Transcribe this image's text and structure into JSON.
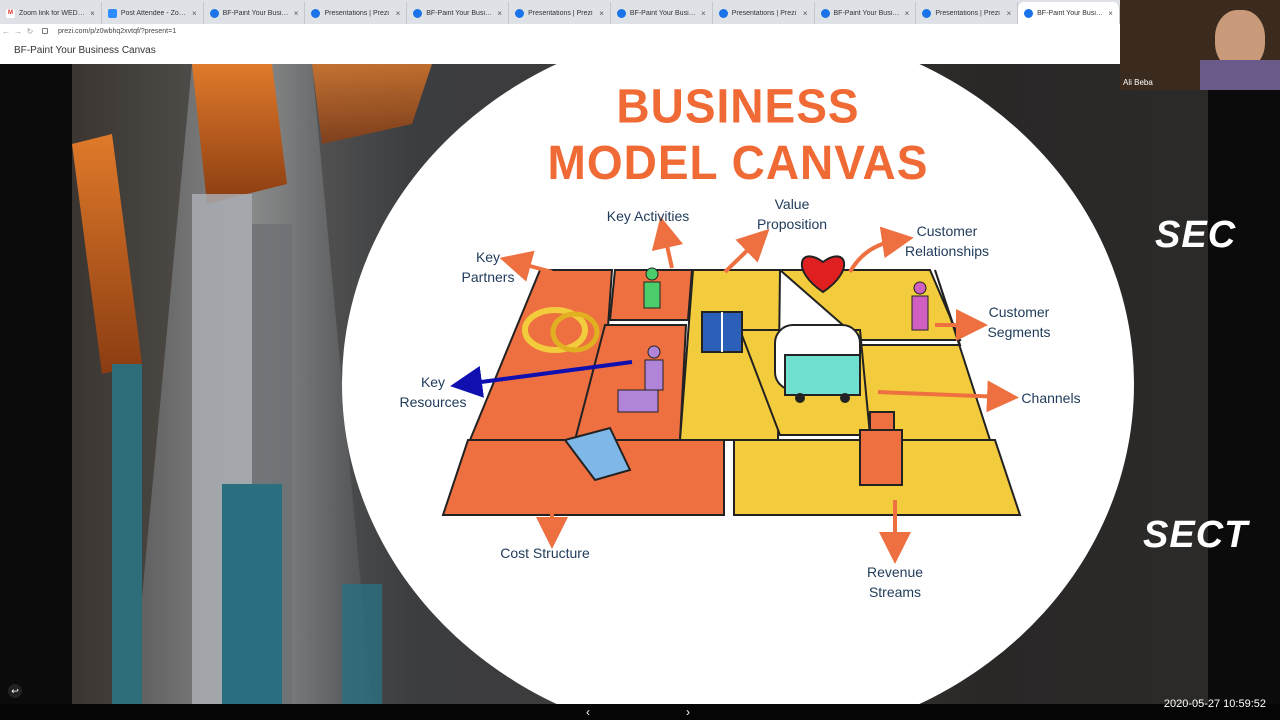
{
  "browser": {
    "tabs": [
      {
        "title": "Zoom link for WEDC Bus",
        "icon": "gmail-icon"
      },
      {
        "title": "Post Attendee - Zoom",
        "icon": "zoom-icon"
      },
      {
        "title": "BF-Paint Your Business C",
        "icon": "prezi-icon"
      },
      {
        "title": "Presentations | Prezi",
        "icon": "prezi-icon"
      },
      {
        "title": "BF-Paint Your Business C",
        "icon": "prezi-icon"
      },
      {
        "title": "Presentations | Prezi",
        "icon": "prezi-icon"
      },
      {
        "title": "BF-Paint Your Business C",
        "icon": "prezi-icon"
      },
      {
        "title": "Presentations | Prezi",
        "icon": "prezi-icon"
      },
      {
        "title": "BF-Paint Your Business C",
        "icon": "prezi-icon"
      },
      {
        "title": "Presentations | Prezi",
        "icon": "prezi-icon"
      },
      {
        "title": "BF-Paint Your Business C",
        "icon": "prezi-icon"
      }
    ],
    "url": "prezi.com/p/z0wbhq2xvtqf/?present=1"
  },
  "app": {
    "title": "BF-Paint Your Business Canvas"
  },
  "slide": {
    "title": "BUSINESS MODEL CANVAS",
    "labels": {
      "key_partners": "Key\nPartners",
      "key_activities": "Key Activities",
      "value_proposition": "Value\nProposition",
      "customer_relationships": "Customer\nRelationships",
      "customer_segments": "Customer\nSegments",
      "key_resources": "Key\nResources",
      "channels": "Channels",
      "cost_structure": "Cost Structure",
      "revenue_streams": "Revenue\nStreams"
    },
    "side_text_1": "SEC",
    "side_text_2": "SECT"
  },
  "colors": {
    "orange": "#ee7040",
    "yellow": "#f2cc3c",
    "title": "#f06a35",
    "label": "#1f3a5a",
    "annotation": "#1010b0"
  },
  "video": {
    "participant": "Ali Beba"
  },
  "footer": {
    "timestamp": "2020-05-27 10:59:52",
    "prev": "‹",
    "next": "›",
    "back": "↩"
  }
}
